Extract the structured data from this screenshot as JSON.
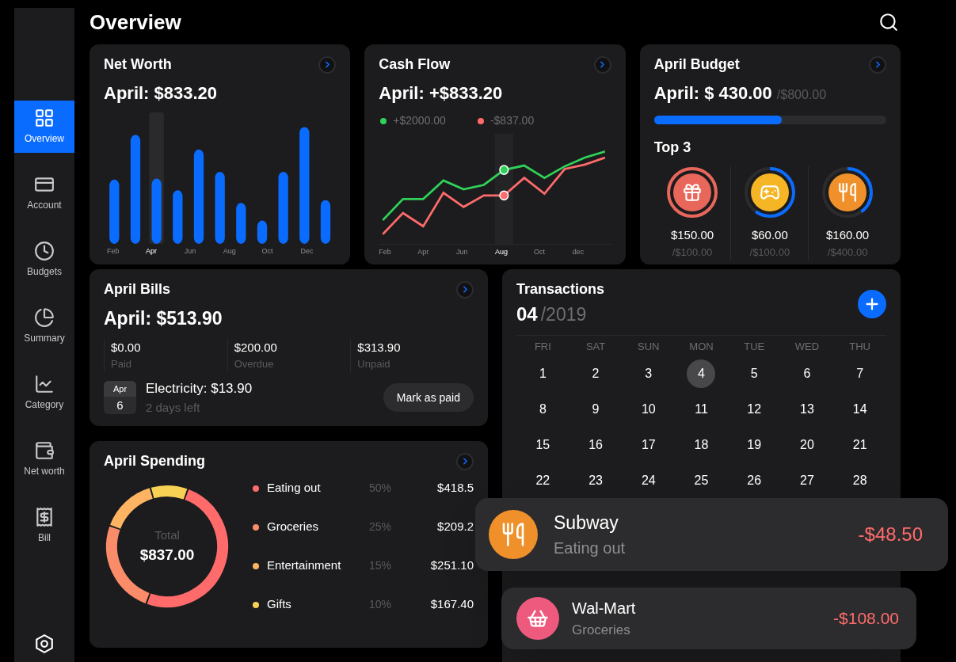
{
  "header": {
    "title": "Overview"
  },
  "sidebar": {
    "items": [
      {
        "label": "Overview",
        "selected": true
      },
      {
        "label": "Account",
        "selected": false
      },
      {
        "label": "Budgets",
        "selected": false
      },
      {
        "label": "Summary",
        "selected": false
      },
      {
        "label": "Category",
        "selected": false
      },
      {
        "label": "Net worth",
        "selected": false
      },
      {
        "label": "Bill",
        "selected": false
      }
    ]
  },
  "net_worth": {
    "title": "Net Worth",
    "amount": "April: $833.20",
    "x_labels": [
      {
        "label": "Feb",
        "selected": false
      },
      {
        "label": "Apr",
        "selected": true
      },
      {
        "label": "Jun",
        "selected": false
      },
      {
        "label": "Aug",
        "selected": false
      },
      {
        "label": "Oct",
        "selected": false
      },
      {
        "label": "Dec",
        "selected": false
      }
    ]
  },
  "cash_flow": {
    "title": "Cash Flow",
    "amount": "April: +$833.20",
    "legend": [
      {
        "label": "+$2000.00",
        "color": "#30d158"
      },
      {
        "label": "-$837.00",
        "color": "#ff6b6b"
      }
    ],
    "x_labels": [
      {
        "label": "Feb",
        "selected": false
      },
      {
        "label": "Apr",
        "selected": false
      },
      {
        "label": "Jun",
        "selected": false
      },
      {
        "label": "Aug",
        "selected": true
      },
      {
        "label": "Oct",
        "selected": false
      },
      {
        "label": "dec",
        "selected": false
      }
    ]
  },
  "budget": {
    "title": "April Budget",
    "amount": "April: $ 430.00",
    "limit": "/$800.00",
    "level": 0.55,
    "top_title": "Top 3",
    "top": [
      {
        "color": "#e8665a",
        "spent": "$150.00",
        "limit": "/$100.00"
      },
      {
        "color": "#f5b524",
        "spent": "$60.00",
        "limit": "/$100.00"
      },
      {
        "color": "#f0902a",
        "spent": "$160.00",
        "limit": "/$400.00"
      }
    ]
  },
  "bills": {
    "title": "April Bills",
    "amount": "April: $513.90",
    "stats": [
      {
        "value": "$0.00",
        "label": "Paid"
      },
      {
        "value": "$200.00",
        "label": "Overdue"
      },
      {
        "value": "$313.90",
        "label": "Unpaid"
      }
    ],
    "next": {
      "month": "Apr",
      "day": "6",
      "name": "Electricity: $13.90",
      "due": "2 days left",
      "action": "Mark as paid"
    }
  },
  "spending": {
    "title": "April Spending",
    "total_label": "Total",
    "total": "$837.00",
    "items": [
      {
        "label": "Eating out",
        "percent": "50%",
        "amount": "$418.5",
        "color": "#ff6b6b"
      },
      {
        "label": "Groceries",
        "percent": "25%",
        "amount": "$209.2",
        "color": "#fb8c6a"
      },
      {
        "label": "Entertainment",
        "percent": "15%",
        "amount": "$251.10",
        "color": "#fdb462"
      },
      {
        "label": "Gifts",
        "percent": "10%",
        "amount": "$167.40",
        "color": "#f7d154"
      }
    ]
  },
  "transactions": {
    "title": "Transactions",
    "month": "04",
    "year": "/2019",
    "weekdays": [
      "FRI",
      "SAT",
      "SUN",
      "MON",
      "TUE",
      "WED",
      "THU"
    ],
    "days": [
      {
        "label": "1",
        "selected": false
      },
      {
        "label": "2",
        "selected": false
      },
      {
        "label": "3",
        "selected": false
      },
      {
        "label": "4",
        "selected": true
      },
      {
        "label": "5",
        "selected": false
      },
      {
        "label": "6",
        "selected": false
      },
      {
        "label": "7",
        "selected": false
      },
      {
        "label": "8",
        "selected": false
      },
      {
        "label": "9",
        "selected": false
      },
      {
        "label": "10",
        "selected": false
      },
      {
        "label": "11",
        "selected": false
      },
      {
        "label": "12",
        "selected": false
      },
      {
        "label": "13",
        "selected": false
      },
      {
        "label": "14",
        "selected": false
      },
      {
        "label": "15",
        "selected": false
      },
      {
        "label": "16",
        "selected": false
      },
      {
        "label": "17",
        "selected": false
      },
      {
        "label": "18",
        "selected": false
      },
      {
        "label": "19",
        "selected": false
      },
      {
        "label": "20",
        "selected": false
      },
      {
        "label": "21",
        "selected": false
      },
      {
        "label": "22",
        "selected": false
      },
      {
        "label": "23",
        "selected": false
      },
      {
        "label": "24",
        "selected": false
      },
      {
        "label": "25",
        "selected": false
      },
      {
        "label": "26",
        "selected": false
      },
      {
        "label": "27",
        "selected": false
      },
      {
        "label": "28",
        "selected": false
      }
    ]
  },
  "toasts": [
    {
      "color": "#f0902a",
      "name": "Subway",
      "category": "Eating out",
      "amount": "-$48.50"
    },
    {
      "color": "#ee5a7d",
      "name": "Wal-Mart",
      "category": "Groceries",
      "amount": "-$108.00"
    }
  ]
}
